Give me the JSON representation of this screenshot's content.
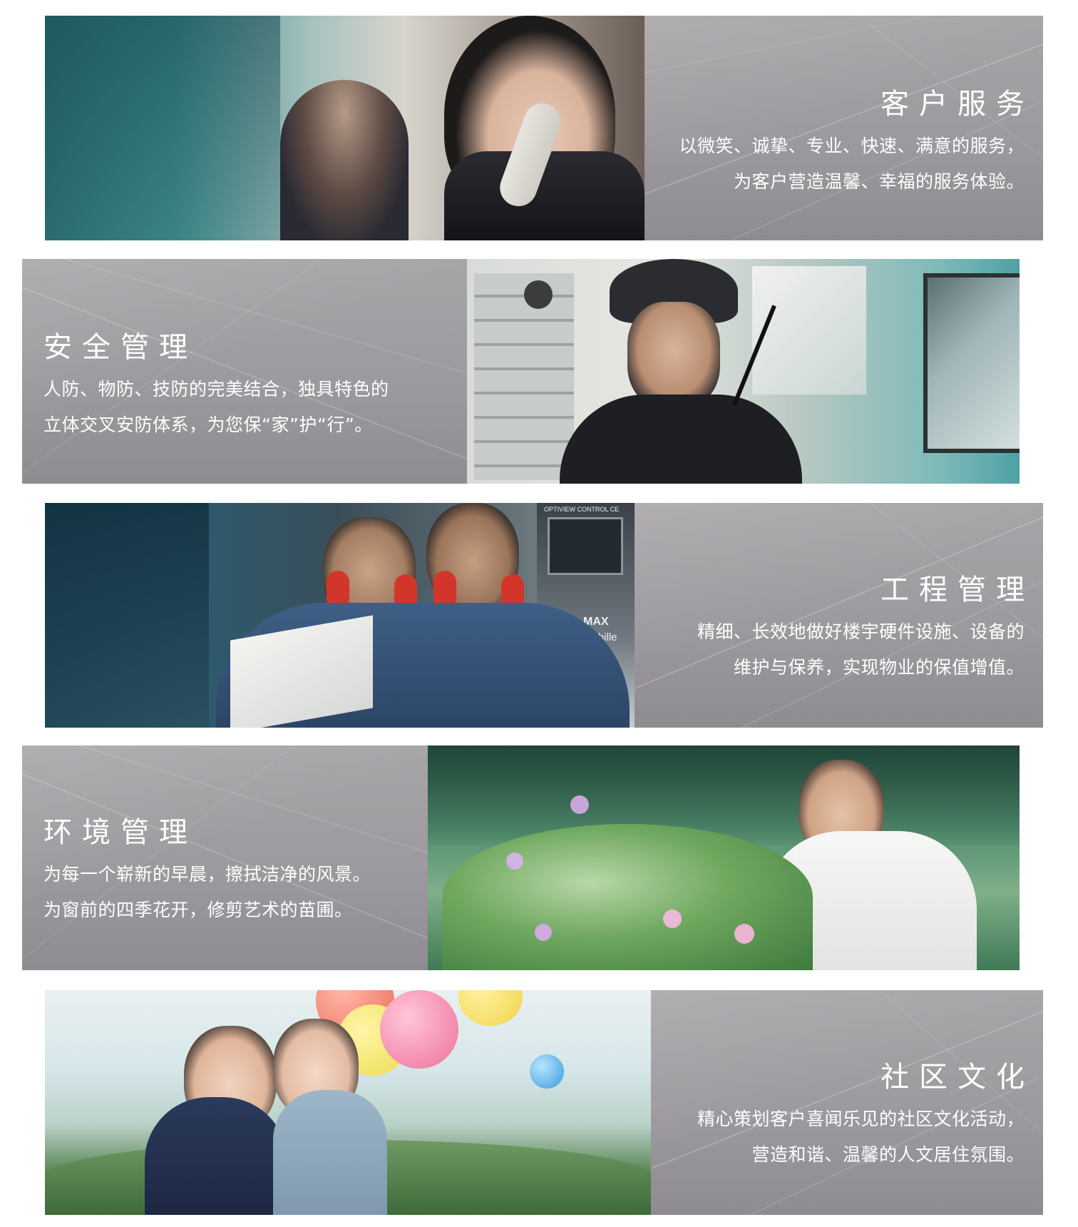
{
  "banners": [
    {
      "title": "客户服务",
      "lines": [
        "以微笑、诚挚、专业、快速、满意的服务，",
        "为客户营造温馨、幸福的服务体验。"
      ]
    },
    {
      "title": "安全管理",
      "lines": [
        "人防、物防、技防的完美结合，独具特色的",
        "立体交叉安防体系，为您保“家”护“行”。"
      ]
    },
    {
      "title": "工程管理",
      "lines": [
        "精细、长效地做好楼宇硬件设施、设备的",
        "维护与保养，实现物业的保值增值。"
      ],
      "photo_text": [
        "OPTIVIEW CONTROL CE",
        "MAX",
        "w Chille"
      ]
    },
    {
      "title": "环境管理",
      "lines": [
        "为每一个崭新的早晨，擦拭洁净的风景。",
        "为窗前的四季花开，修剪艺术的苗圃。"
      ]
    },
    {
      "title": "社区文化",
      "lines": [
        "精心策划客户喜闻乐见的社区文化活动，",
        "营造和谐、温馨的人文居住氛围。"
      ]
    }
  ]
}
